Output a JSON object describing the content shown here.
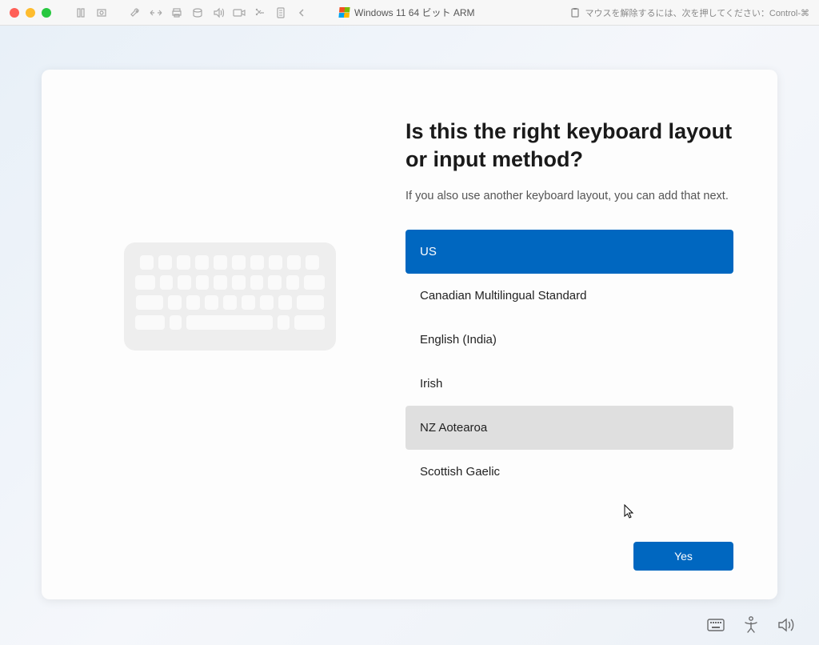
{
  "toolbar": {
    "title": "Windows 11 64 ビット ARM",
    "right_text": "マウスを解除するには、次を押してください：Control-⌘"
  },
  "oobe": {
    "heading": "Is this the right keyboard layout or input method?",
    "subheading": "If you also use another keyboard layout, you can add that next.",
    "layouts": [
      {
        "label": "US",
        "state": "selected"
      },
      {
        "label": "Canadian Multilingual Standard",
        "state": ""
      },
      {
        "label": "English (India)",
        "state": ""
      },
      {
        "label": "Irish",
        "state": ""
      },
      {
        "label": "NZ Aotearoa",
        "state": "hovered"
      },
      {
        "label": "Scottish Gaelic",
        "state": ""
      }
    ],
    "yes_label": "Yes"
  }
}
